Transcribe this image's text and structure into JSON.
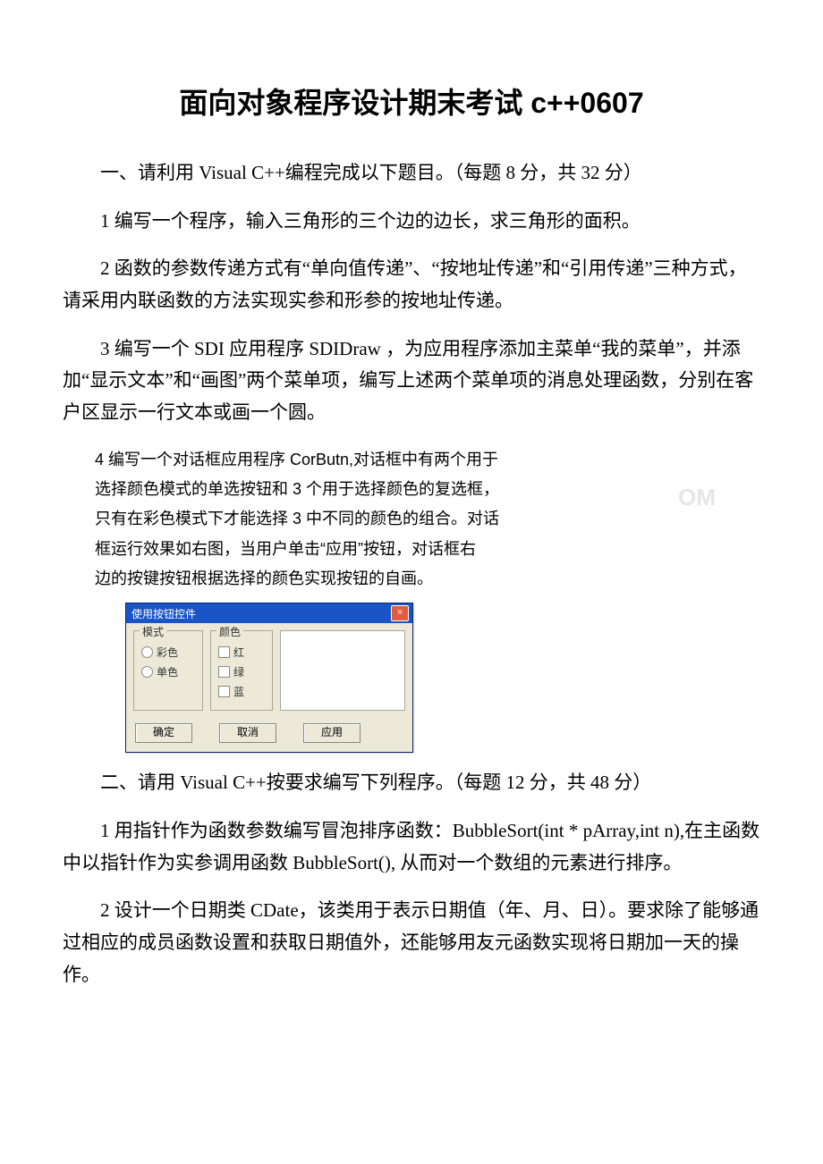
{
  "title": "面向对象程序设计期末考试 c++0607",
  "section1": {
    "heading": "一、请利用 Visual C++编程完成以下题目。（每题 8 分，共 32 分）",
    "q1": "1 编写一个程序，输入三角形的三个边的边长，求三角形的面积。",
    "q2": "2 函数的参数传递方式有“单向值传递”、“按地址传递”和“引用传递”三种方式， 请采用内联函数的方法实现实参和形参的按地址传递。",
    "q3": "3 编写一个 SDI 应用程序 SDIDraw ，为应用程序添加主菜单“我的菜单”，并添加“显示文本”和“画图”两个菜单项，编写上述两个菜单项的消息处理函数，分别在客户区显示一行文本或画一个圆。",
    "q4_lines": [
      "4 编写一个对话框应用程序 CorButn,对话框中有两个用于",
      "选择颜色模式的单选按钮和 3 个用于选择颜色的复选框，",
      "只有在彩色模式下才能选择 3 中不同的颜色的组合。对话",
      "框运行效果如右图，当用户单击“应用”按钮，对话框右",
      "边的按键按钮根据选择的颜色实现按钮的自画。"
    ]
  },
  "dialog": {
    "title": "使用按钮控件",
    "group_mode": "模式",
    "radio_color": "彩色",
    "radio_mono": "单色",
    "group_color": "颜色",
    "check_r": "红",
    "check_g": "绿",
    "check_b": "蓝",
    "btn_ok": "确定",
    "btn_cancel": "取消",
    "btn_apply": "应用"
  },
  "section2": {
    "heading": "二、请用 Visual C++按要求编写下列程序。（每题 12 分，共 48 分）",
    "q1": "1 用指针作为函数参数编写冒泡排序函数：BubbleSort(int * pArray,int n),在主函数中以指针作为实参调用函数 BubbleSort(), 从而对一个数组的元素进行排序。",
    "q2": "2 设计一个日期类 CDate，该类用于表示日期值（年、月、日）。要求除了能够通过相应的成员函数设置和获取日期值外，还能够用友元函数实现将日期加一天的操作。"
  },
  "watermark": "OM"
}
